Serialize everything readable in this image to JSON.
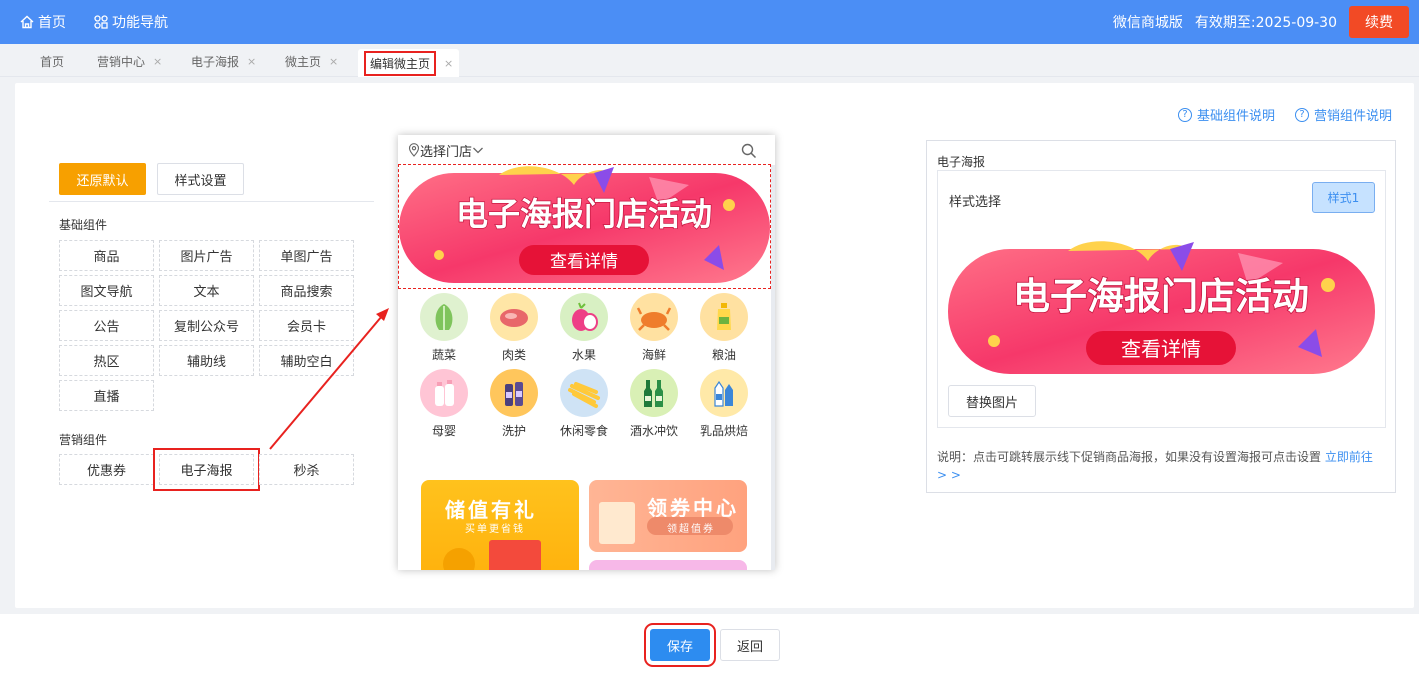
{
  "topbar": {
    "home_label": "首页",
    "nav_label": "功能导航",
    "edition": "微信商城版",
    "expiry": "有效期至:2025-09-30",
    "renew_label": "续费"
  },
  "tabs": [
    {
      "label": "首页",
      "closable": false
    },
    {
      "label": "营销中心",
      "closable": true
    },
    {
      "label": "电子海报",
      "closable": true
    },
    {
      "label": "微主页",
      "closable": true
    },
    {
      "label": "编辑微主页",
      "closable": true,
      "active": true
    }
  ],
  "help": {
    "basic": "基础组件说明",
    "marketing": "营销组件说明"
  },
  "palette": {
    "restore_label": "还原默认",
    "style_label": "样式设置",
    "basic_title": "基础组件",
    "basic_items": [
      "商品",
      "图片广告",
      "单图广告",
      "图文导航",
      "文本",
      "商品搜索",
      "公告",
      "复制公众号",
      "会员卡",
      "热区",
      "辅助线",
      "辅助空白",
      "直播"
    ],
    "marketing_title": "营销组件",
    "marketing_items": [
      "优惠券",
      "电子海报",
      "秒杀"
    ]
  },
  "phone": {
    "store_select": "选择门店",
    "poster_title": "电子海报门店活动",
    "poster_button": "查看详情",
    "categories": [
      "蔬菜",
      "肉类",
      "水果",
      "海鲜",
      "粮油",
      "母婴",
      "洗护",
      "休闲零食",
      "酒水冲饮",
      "乳品烘焙"
    ],
    "promo1_title": "储值有礼",
    "promo1_sub": "买单更省钱",
    "promo2_title": "领券中心",
    "promo2_sub": "领超值券"
  },
  "settings": {
    "title": "电子海报",
    "style_label": "样式选择",
    "style_value": "样式1",
    "replace_label": "替换图片",
    "note": "说明：点击可跳转展示线下促销商品海报，如果没有设置海报可点击设置",
    "note_link": "立即前往",
    "note_link2": "> >"
  },
  "footer": {
    "save_label": "保存",
    "back_label": "返回"
  },
  "colors": {
    "topbar": "#4b8ef5",
    "renew": "#f24a25",
    "restore": "#f7a000",
    "primary": "#2d8cf0",
    "highlight": "#e8221f"
  }
}
